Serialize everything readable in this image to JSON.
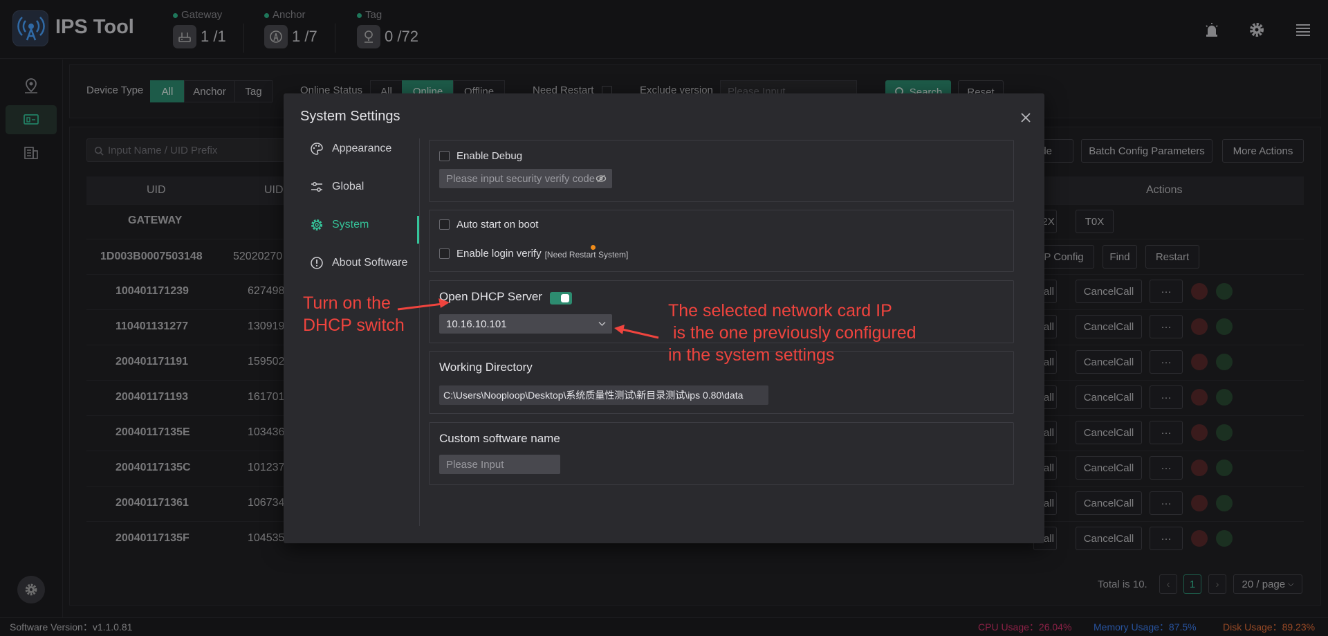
{
  "app": {
    "title": "IPS Tool"
  },
  "stats": [
    {
      "label": "Gateway",
      "value": "1 /1",
      "icon": "router-icon"
    },
    {
      "label": "Anchor",
      "value": "1 /7",
      "icon": "anchor-icon"
    },
    {
      "label": "Tag",
      "value": "0 /72",
      "icon": "tag-pin-icon"
    }
  ],
  "filters": {
    "device_type_label": "Device Type",
    "device_types": [
      "All",
      "Anchor",
      "Tag"
    ],
    "device_type_selected": "All",
    "online_status_label": "Online Status",
    "online_statuses": [
      "All",
      "Online",
      "Offline"
    ],
    "online_status_selected": "Online",
    "need_restart_label": "Need Restart",
    "exclude_version_label": "Exclude version",
    "exclude_version_placeholder": "Please Input",
    "search_label": "Search",
    "reset_label": "Reset"
  },
  "table": {
    "search_placeholder": "Input Name / UID Prefix",
    "toolbar": {
      "upgrade": "rade",
      "batch_config": "Batch Config Parameters",
      "more_actions": "More Actions"
    },
    "headers": {
      "uid": "UID",
      "uid2": "UID(",
      "actions": "Actions"
    },
    "gateway_row": {
      "uid": "GATEWAY",
      "btn1": "T2X",
      "btn2": "T0X"
    },
    "anchor_row": {
      "uid": "1D003B0007503148",
      "uid2": "52020270",
      "btn1": "P Config",
      "btn2": "Find",
      "btn3": "Restart"
    },
    "tag_rows": [
      {
        "uid": "100401171239",
        "uid2": "627498"
      },
      {
        "uid": "110401131277",
        "uid2": "130919"
      },
      {
        "uid": "200401171191",
        "uid2": "159502"
      },
      {
        "uid": "200401171193",
        "uid2": "161701"
      },
      {
        "uid": "20040117135E",
        "uid2": "103436"
      },
      {
        "uid": "20040117135C",
        "uid2": "101237"
      },
      {
        "uid": "200401171361",
        "uid2": "106734"
      },
      {
        "uid": "20040117135F",
        "uid2": "104535"
      }
    ],
    "tag_row_buttons": {
      "call": "Call",
      "cancel_call": "CancelCall",
      "more": "···"
    },
    "pagination": {
      "total": "Total is 10.",
      "page": "1",
      "page_size": "20 / page"
    }
  },
  "status_bar": {
    "version": "Software Version：v1.1.0.81",
    "cpu": "CPU Usage：26.04%",
    "memory": "Memory Usage：87.5%",
    "disk": "Disk Usage：89.23%",
    "cpu_color": "#d6336c",
    "memory_color": "#3d7ef0",
    "disk_color": "#e8703a"
  },
  "modal": {
    "title": "System Settings",
    "menu": [
      {
        "label": "Appearance",
        "icon": "palette-icon"
      },
      {
        "label": "Global",
        "icon": "sliders-icon"
      },
      {
        "label": "System",
        "icon": "gear-icon"
      },
      {
        "label": "About Software",
        "icon": "info-icon"
      }
    ],
    "active_menu": "System",
    "debug": {
      "enable_label": "Enable Debug",
      "placeholder": "Please input security verify code"
    },
    "boot": {
      "auto_start_label": "Auto start on boot",
      "login_verify_label": "Enable login verify",
      "restart_note": "[Need Restart System]"
    },
    "dhcp": {
      "label": "Open DHCP Server",
      "enabled": true,
      "selected_ip": "10.16.10.101"
    },
    "workdir": {
      "label": "Working Directory",
      "value": "C:\\Users\\Nooploop\\Desktop\\系统质量性测试\\新目录测试\\ips 0.80\\data"
    },
    "custom_name": {
      "label": "Custom software name",
      "placeholder": "Please Input"
    }
  },
  "annotations": {
    "dhcp_note": [
      "Turn on the",
      "DHCP switch"
    ],
    "ip_note": [
      "The selected network card IP",
      " is the one previously configured",
      "in the system settings"
    ],
    "color": "#f0443e"
  }
}
